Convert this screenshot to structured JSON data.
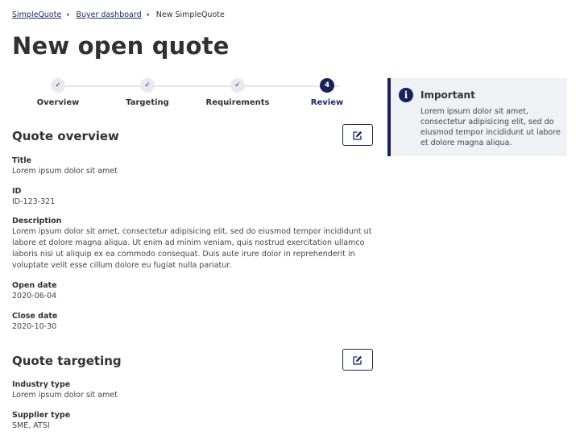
{
  "breadcrumb": {
    "items": [
      "SimpleQuote",
      "Buyer dashboard"
    ],
    "current": "New SimpleQuote"
  },
  "page": {
    "title": "New open quote"
  },
  "stepper": {
    "steps": [
      {
        "label": "Overview",
        "status": "complete",
        "marker": "✓"
      },
      {
        "label": "Targeting",
        "status": "complete",
        "marker": "✓"
      },
      {
        "label": "Requirements",
        "status": "complete",
        "marker": "✓"
      },
      {
        "label": "Review",
        "status": "active",
        "marker": "4"
      }
    ]
  },
  "overview": {
    "heading": "Quote overview",
    "edit_icon": "edit-icon",
    "fields": [
      {
        "label": "Title",
        "value": "Lorem ipsum dolor sit amet"
      },
      {
        "label": "ID",
        "value": "ID-123-321"
      },
      {
        "label": "Description",
        "value": "Lorem ipsum dolor sit amet, consectetur adipisicing elit, sed do eiusmod tempor incididunt ut labore et dolore magna aliqua. Ut enim ad minim veniam, quis nostrud exercitation ullamco laboris nisi ut aliquip ex ea commodo consequat. Duis aute irure dolor in reprehenderit in voluptate velit esse cillum dolore eu fugiat nulla pariatur."
      },
      {
        "label": "Open date",
        "value": "2020-06-04"
      },
      {
        "label": "Close date",
        "value": "2020-10-30"
      }
    ]
  },
  "targeting": {
    "heading": "Quote targeting",
    "edit_icon": "edit-icon",
    "fields": [
      {
        "label": "Industry type",
        "value": "Lorem ipsum dolor sit amet"
      },
      {
        "label": "Supplier type",
        "value": "SME, ATSI"
      }
    ]
  },
  "callout": {
    "icon": "info-icon",
    "title": "Important",
    "text": "Lorem ipsum dolor sit amet, consectetur adipisicing elit, sed do eiusmod tempor incididunt ut labore et dolore magna aliqua."
  },
  "colors": {
    "primary": "#17235a",
    "link": "#1b2a6b",
    "text": "#313131",
    "callout_bg": "#f0f1f4"
  }
}
